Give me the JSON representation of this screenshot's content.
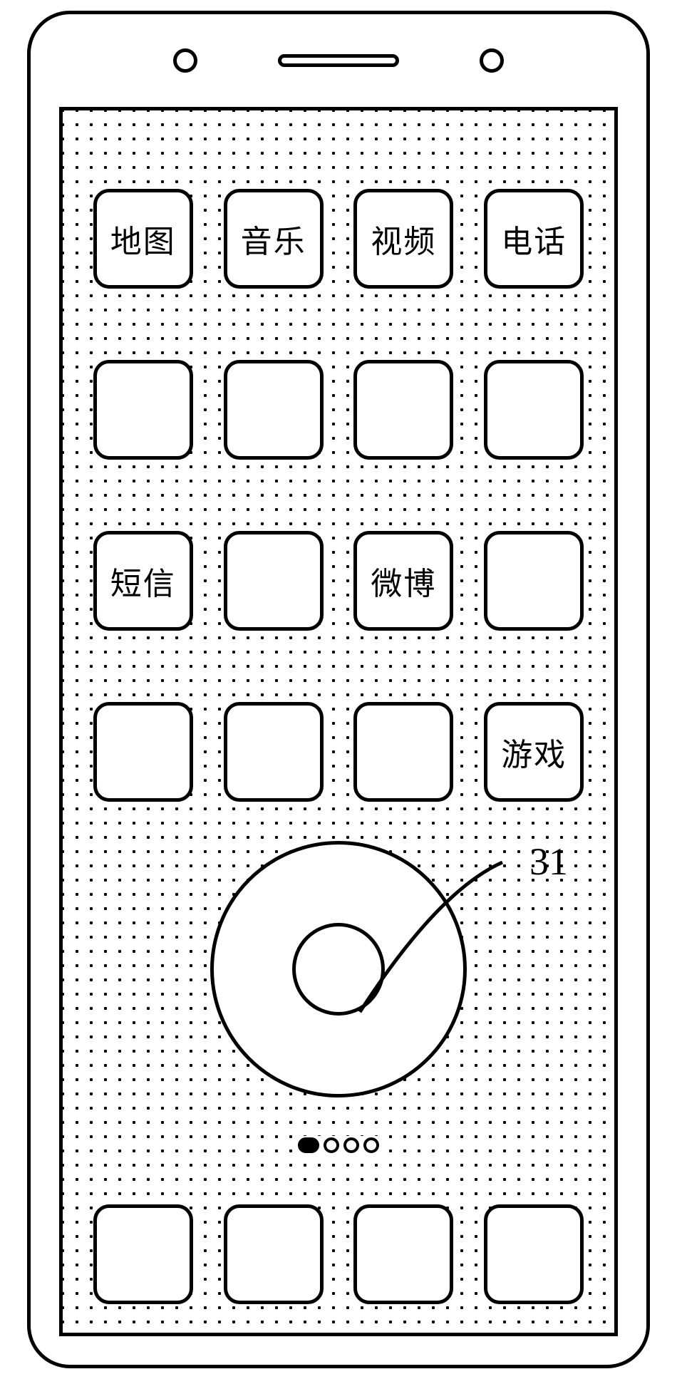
{
  "figure": {
    "callout_label": "31"
  },
  "homescreen": {
    "rows": 4,
    "cols": 4,
    "apps": [
      {
        "label": "地图"
      },
      {
        "label": "音乐"
      },
      {
        "label": "视频"
      },
      {
        "label": "电话"
      },
      {
        "label": ""
      },
      {
        "label": ""
      },
      {
        "label": ""
      },
      {
        "label": ""
      },
      {
        "label": "短信"
      },
      {
        "label": ""
      },
      {
        "label": "微博"
      },
      {
        "label": ""
      },
      {
        "label": ""
      },
      {
        "label": ""
      },
      {
        "label": ""
      },
      {
        "label": "游戏"
      }
    ],
    "page_indicator": {
      "total": 4,
      "active": 0
    },
    "dock_apps": [
      {
        "label": ""
      },
      {
        "label": ""
      },
      {
        "label": ""
      },
      {
        "label": ""
      }
    ]
  }
}
